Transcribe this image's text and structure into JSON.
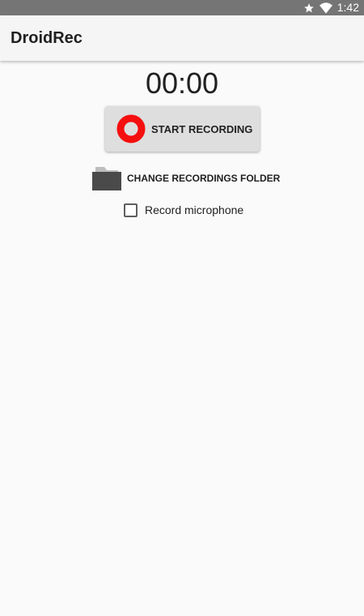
{
  "status_bar": {
    "time": "1:42",
    "icons": [
      "star-icon",
      "wifi-icon"
    ]
  },
  "app_bar": {
    "title": "DroidRec"
  },
  "main": {
    "timer": "00:00",
    "record_button_label": "START RECORDING",
    "change_folder_label": "CHANGE RECORDINGS FOLDER",
    "record_microphone_label": "Record microphone",
    "record_microphone_checked": false
  },
  "colors": {
    "status_bar": "#757575",
    "app_bar": "#f5f5f5",
    "background": "#fafafa",
    "record_red": "#f50f0f",
    "button_gray": "#dedede",
    "folder_gray": "#4a4a4a"
  }
}
